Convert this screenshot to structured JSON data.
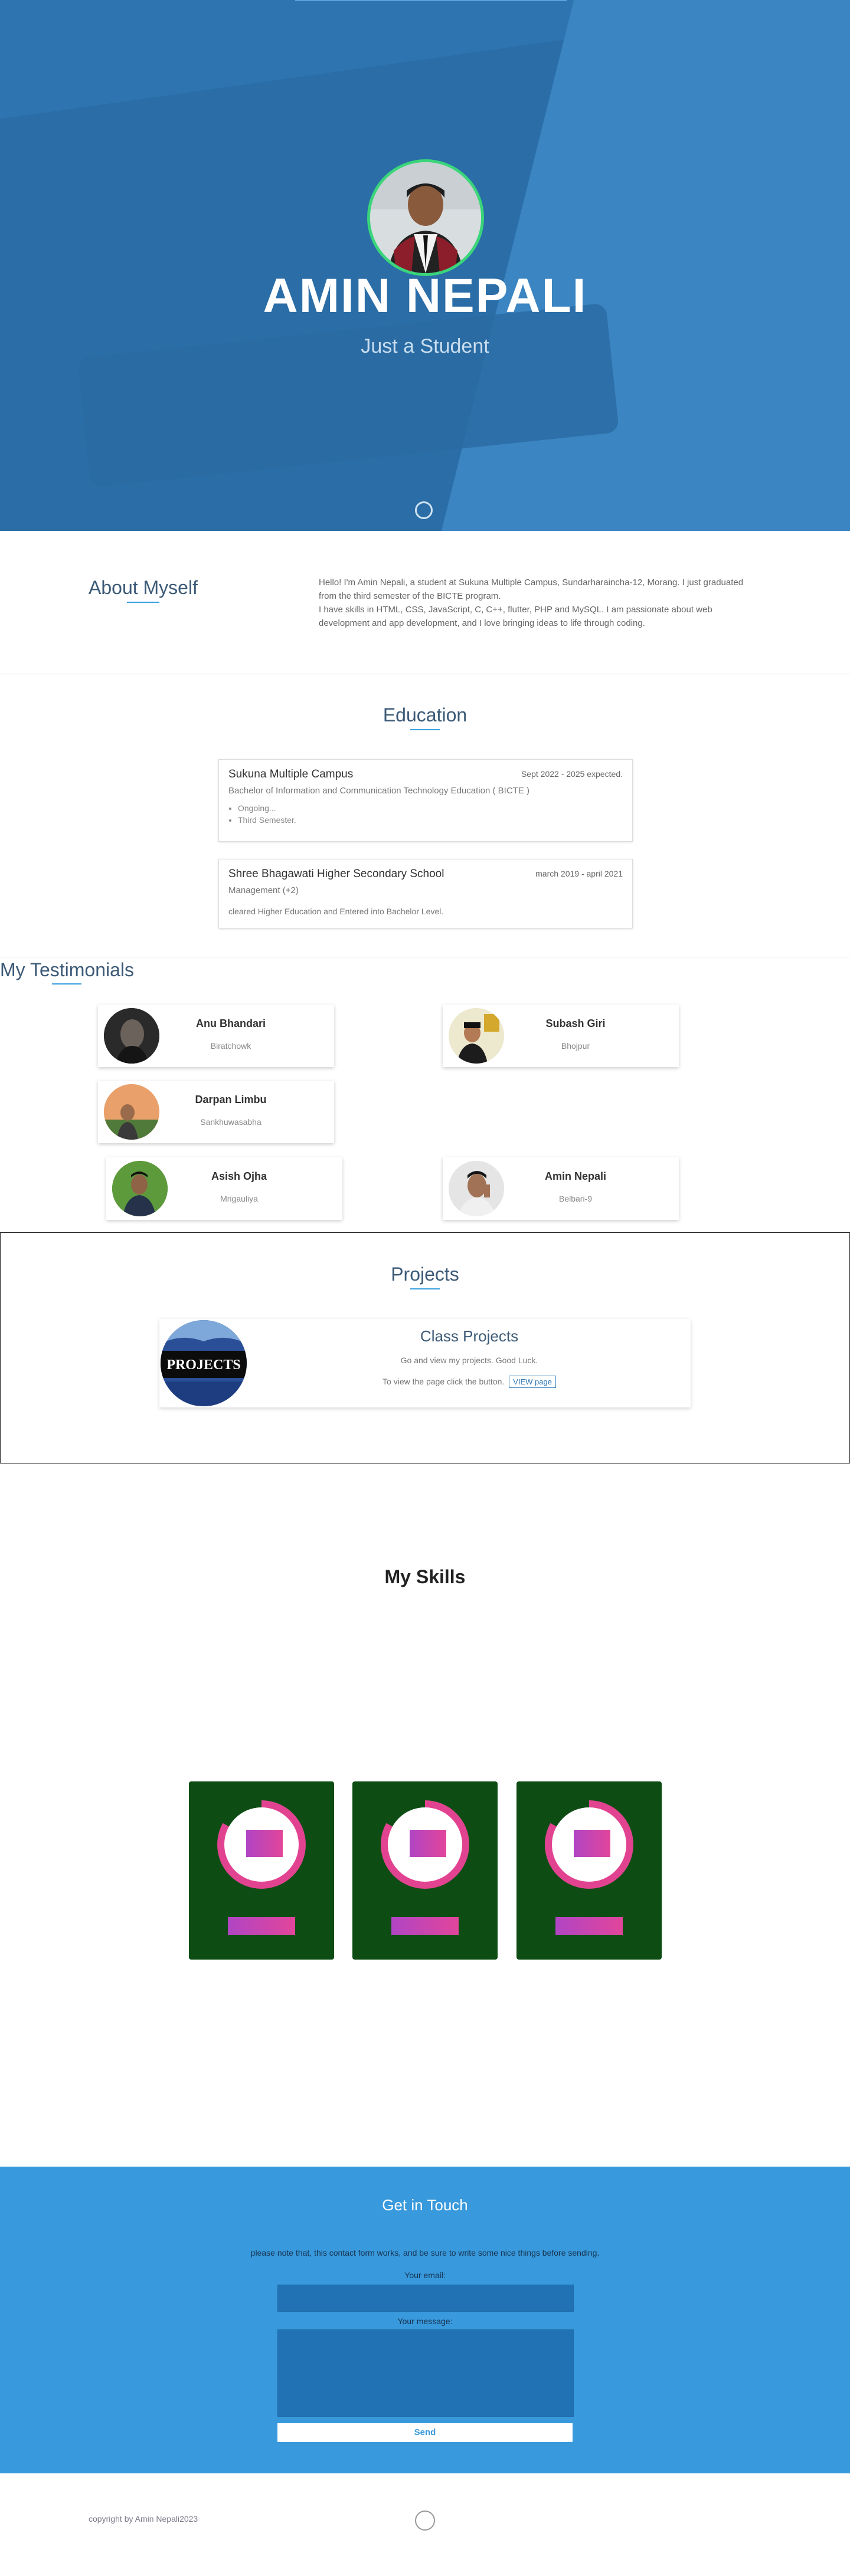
{
  "hero": {
    "name": "AMIN NEPALI",
    "subtitle": "Just a Student"
  },
  "about": {
    "title": "About Myself",
    "text_line1": "Hello! I'm Amin Nepali, a student at Sukuna Multiple Campus, Sundarharaincha-12, Morang. I just graduated from the third semester of the BICTE program.",
    "text_line2": "I have skills in HTML, CSS, JavaScript, C, C++, flutter, PHP and MySQL. I am passionate about web development and app development, and I love bringing ideas to life through coding."
  },
  "education": {
    "title": "Education",
    "items": [
      {
        "school": "Sukuna Multiple Campus",
        "date": "Sept 2022 - 2025 expected.",
        "degree": "Bachelor of Information and Communication Technology Education ( BICTE )",
        "bullets": [
          "Ongoing...",
          "Third Semester."
        ]
      },
      {
        "school": "Shree Bhagawati Higher Secondary School",
        "date": "march 2019 - april 2021",
        "degree": "Management (+2)",
        "note": "cleared Higher Education and Entered into Bachelor Level."
      }
    ]
  },
  "testimonials": {
    "title": "My Testimonials",
    "items": [
      {
        "name": "Anu Bhandari",
        "place": "Biratchowk"
      },
      {
        "name": "Subash Giri",
        "place": "Bhojpur"
      },
      {
        "name": "Darpan Limbu",
        "place": "Sankhuwasabha"
      },
      {
        "name": "Asish Ojha",
        "place": "Mrigauliya"
      },
      {
        "name": "Amin Nepali",
        "place": "Belbari-9"
      }
    ]
  },
  "projects": {
    "title": "Projects",
    "card_title": "Class Projects",
    "image_text": "PROJECTS",
    "description": "Go and view my projects. Good Luck.",
    "view_text": "To view the page click the button.",
    "button_label": "VIEW page"
  },
  "skills": {
    "title": "My Skills",
    "cards": [
      {
        "level": 0.83,
        "ring_color": "#e24391",
        "card_color": "#0d4d14"
      },
      {
        "level": 0.83,
        "ring_color": "#e24391",
        "card_color": "#0d4d14"
      },
      {
        "level": 0.83,
        "ring_color": "#e24391",
        "card_color": "#0d4d14"
      }
    ]
  },
  "contact": {
    "title": "Get in Touch",
    "note": "please note that, this contact form works, and be sure to write some nice things before sending.",
    "email_label": "Your email:",
    "message_label": "Your message:",
    "send_label": "Send",
    "background_color": "#3899dc"
  },
  "footer": {
    "copyright": "copyright by Amin Nepali2023"
  },
  "colors": {
    "hero_bg": "#2d74b0",
    "accent": "#3aa0e0",
    "avatar_ring": "#3ad57a"
  }
}
